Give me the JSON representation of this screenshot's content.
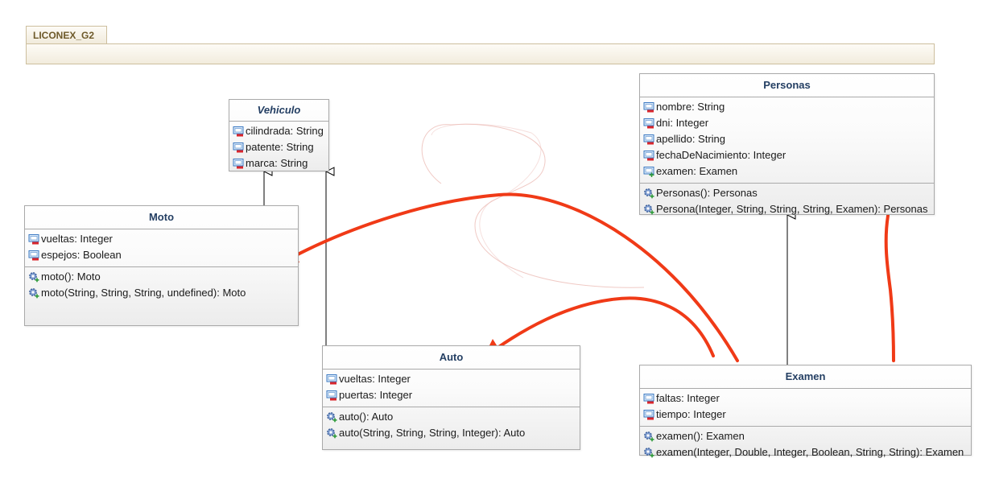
{
  "package": {
    "name": "LICONEX_G2"
  },
  "classes": {
    "vehiculo": {
      "name": "Vehiculo",
      "attributes": [
        "cilindrada: String",
        "patente: String",
        "marca: String"
      ]
    },
    "moto": {
      "name": "Moto",
      "attributes": [
        "vueltas: Integer",
        "espejos: Boolean"
      ],
      "methods": [
        "moto(): Moto",
        "moto(String, String, String, undefined): Moto"
      ]
    },
    "auto": {
      "name": "Auto",
      "attributes": [
        "vueltas: Integer",
        "puertas: Integer"
      ],
      "methods": [
        "auto(): Auto",
        "auto(String, String, String, Integer): Auto"
      ]
    },
    "personas": {
      "name": "Personas",
      "attributes": [
        "nombre: String",
        "dni: Integer",
        "apellido: String",
        "fechaDeNacimiento: Integer",
        "examen: Examen"
      ],
      "methods": [
        "Personas(): Personas",
        "Persona(Integer, String, String, String, Examen): Personas"
      ]
    },
    "examen": {
      "name": "Examen",
      "attributes": [
        "faltas: Integer",
        "tiempo: Integer"
      ],
      "methods": [
        "examen(): Examen",
        "examen(Integer, Double, Integer, Boolean, String, String): Examen"
      ]
    }
  },
  "colors": {
    "annotation_red": "#f03a17",
    "title_blue": "#243f63",
    "package_border": "#cdbf9e",
    "attr_icon_blue": "#3a78c2",
    "private_marker_red": "#d9262c",
    "public_marker_green": "#2e9a3a"
  },
  "icons": {
    "attribute_private": "field-private-icon",
    "attribute_public": "field-public-icon",
    "method_public": "method-public-icon"
  }
}
